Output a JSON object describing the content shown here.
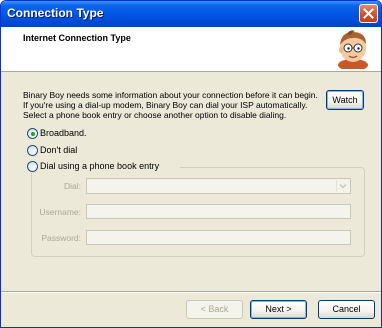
{
  "window": {
    "title": "Connection Type"
  },
  "header": {
    "title": "Internet Connection Type"
  },
  "description": {
    "lines": [
      "Binary Boy needs some information about your connection before it can begin.",
      "If you're using a dial-up modem, Binary Boy can dial your ISP automatically.",
      "Select a phone book entry or choose another option to disable dialing."
    ]
  },
  "watch_button": {
    "label": "Watch"
  },
  "options": [
    {
      "label": "Broadband.",
      "selected": true
    },
    {
      "label": "Don't dial",
      "selected": false
    },
    {
      "label": "Dial using a phone book entry",
      "selected": false
    }
  ],
  "dial_group": {
    "dial_label": "Dial:",
    "dial_value": "",
    "username_label": "Username:",
    "username_value": "",
    "password_label": "Password:",
    "password_value": ""
  },
  "footer": {
    "back_label": "< Back",
    "next_label": "Next >",
    "cancel_label": "Cancel"
  },
  "colors": {
    "titlebar": "#0054e3",
    "close_button": "#d0522c",
    "dialog_bg": "#ece9d8",
    "radio_dot": "#21a121"
  }
}
